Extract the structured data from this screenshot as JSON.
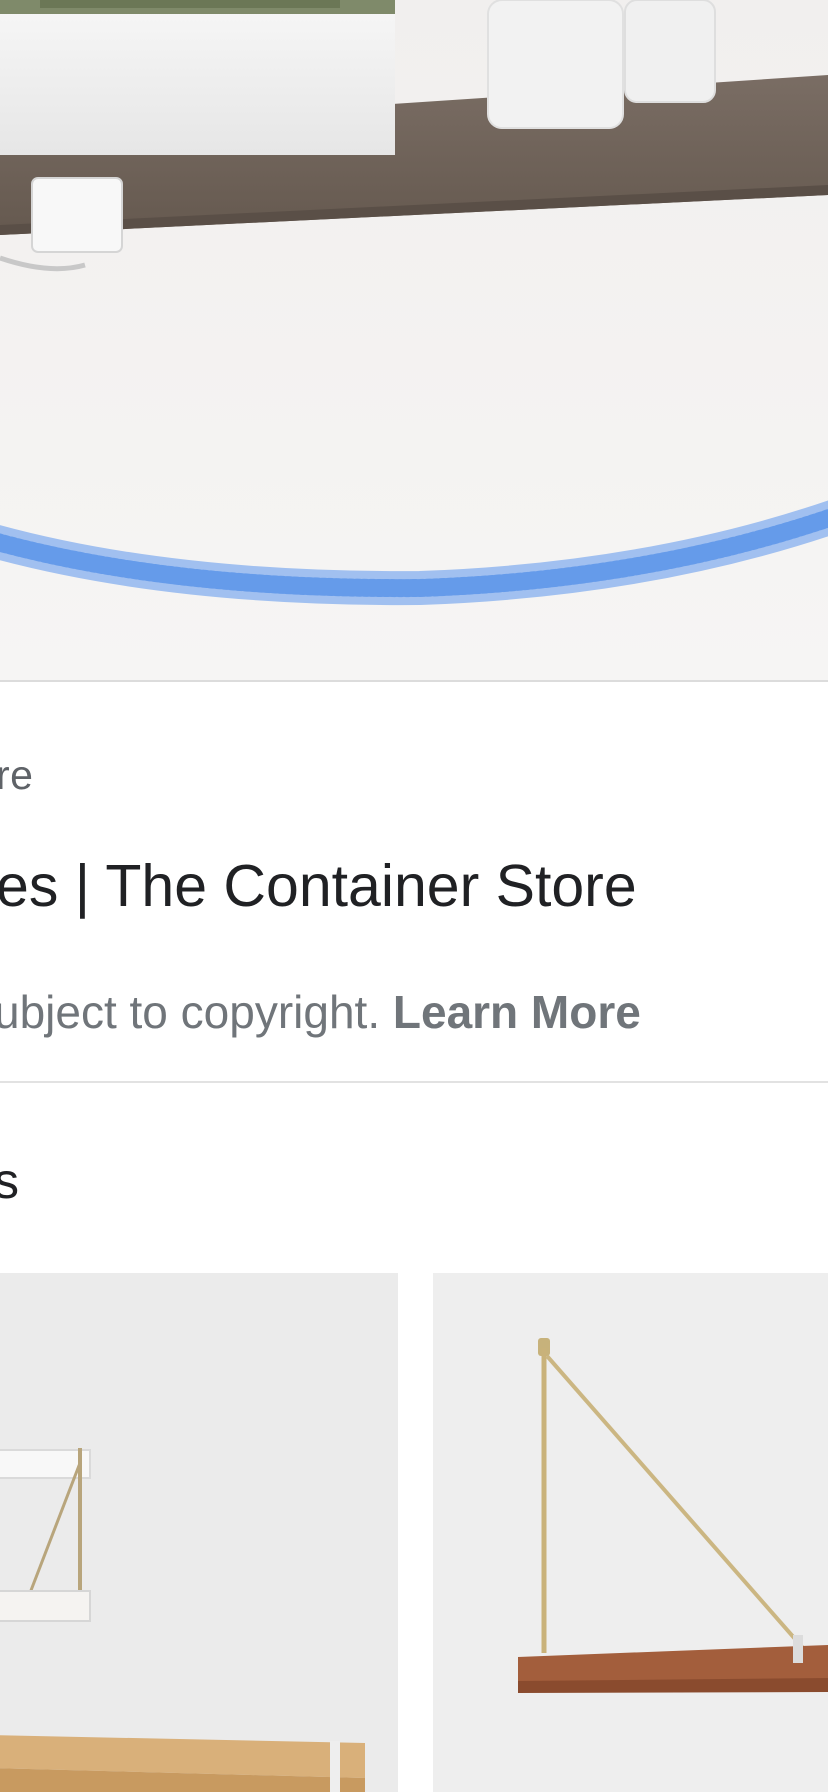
{
  "hero": {
    "description_icon": "product-image"
  },
  "result": {
    "source": "re",
    "title": "es | The Container Store",
    "copyright_text": "ubject to copyright. ",
    "learn_more_label": "Learn More"
  },
  "related": {
    "heading": "s"
  },
  "colors": {
    "shelf_wood": "#6e625a",
    "wall": "#f4f2f1",
    "marker_blue": "#4a8be8",
    "brass": "#c9b27a",
    "copper_shelf": "#9c5a3a"
  }
}
